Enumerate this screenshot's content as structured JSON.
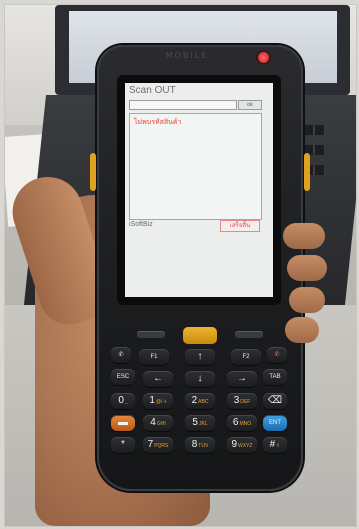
{
  "device": {
    "brand": "MOBILE",
    "screen": {
      "title": "Scan OUT",
      "ok_label": "ok",
      "message": "ไม่พบรหัสสินค้า",
      "footer_label": "iSoftBiz",
      "finish_label": "เสร็จสิ้น"
    },
    "keys": {
      "f1": "F1",
      "up": "↑",
      "f2": "F2",
      "esc": "ESC",
      "left": "←",
      "down": "↓",
      "right": "→",
      "tab": "TAB",
      "k0": "0",
      "k0s": "_",
      "k1": "1",
      "k1s": "@/.+",
      "k2": "2",
      "k2s": "ABC",
      "k3": "3",
      "k3s": "DEF",
      "bksp": "⌫",
      "k4": "4",
      "k4s": "GHI",
      "k5": "5",
      "k5s": "JKL",
      "k6": "6",
      "k6s": "MNO",
      "ent": "ENT",
      "star": "*",
      "k7": "7",
      "k7s": "PQRS",
      "k8": "8",
      "k8s": "TUV",
      "k9": "9",
      "k9s": "WXYZ",
      "hash": "#",
      "shift": "⇧"
    }
  },
  "colors": {
    "accent_key": "#e0a21f",
    "message_red": "#e0483f",
    "enter_blue": "#2f86cf"
  }
}
